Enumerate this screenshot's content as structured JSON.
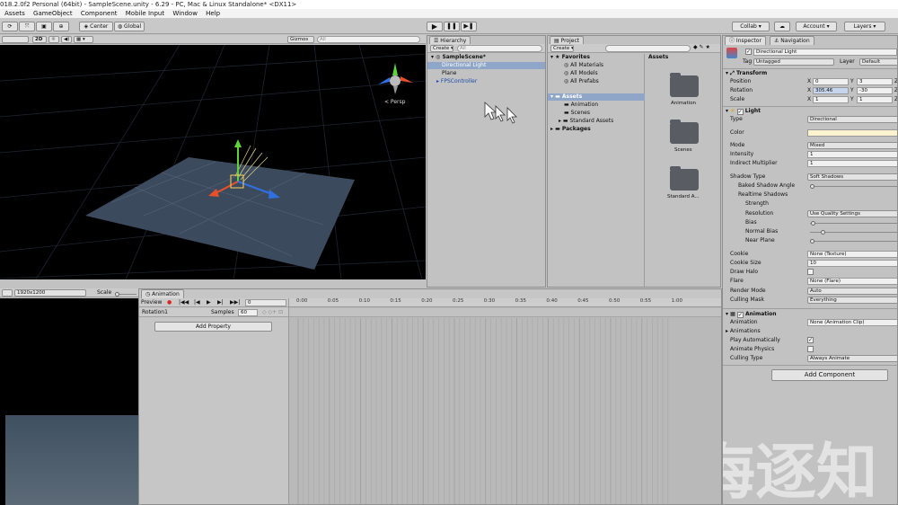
{
  "window": {
    "title": "018.2.0f2 Personal (64bit) - SampleScene.unity - 6.29 - PC, Mac & Linux Standalone* <DX11>"
  },
  "menu": [
    "Assets",
    "GameObject",
    "Component",
    "Mobile Input",
    "Window",
    "Help"
  ],
  "toolbar": {
    "center_label": "Center",
    "global_label": "Global",
    "collab_label": "Collab",
    "account_label": "Account",
    "layers_label": "Layers"
  },
  "scene": {
    "mode_2d": "2D",
    "gizmos_label": "Gizmos",
    "search_placeholder": "All",
    "persp_label": "< Persp"
  },
  "game": {
    "resolution": "1920x1200",
    "scale_label": "Scale"
  },
  "hierarchy": {
    "tab": "Hierarchy",
    "create": "Create",
    "search_placeholder": "All",
    "scene_name": "SampleScene*",
    "items": [
      "Directional Light",
      "Plane",
      "FPSController"
    ]
  },
  "project": {
    "tab": "Project",
    "create": "Create",
    "favorites_label": "Favorites",
    "favorites": [
      "All Materials",
      "All Models",
      "All Prefabs"
    ],
    "assets_label": "Assets",
    "asset_folders": [
      "Animation",
      "Scenes",
      "Standard Assets"
    ],
    "packages_label": "Packages",
    "assets_header": "Assets",
    "grid_items": [
      "Animation",
      "Scenes",
      "Standard A..."
    ]
  },
  "animation": {
    "tab": "Animation",
    "preview_label": "Preview",
    "frame_value": "0",
    "clip_name": "Rotation1",
    "samples_label": "Samples",
    "samples_value": "60",
    "add_property": "Add Property",
    "timeline_ticks": [
      "0:00",
      "0:05",
      "0:10",
      "0:15",
      "0:20",
      "0:25",
      "0:30",
      "0:35",
      "0:40",
      "0:45",
      "0:50",
      "0:55",
      "1:00"
    ]
  },
  "inspector": {
    "tabs": [
      "Inspector",
      "Navigation"
    ],
    "object_name": "Directional Light",
    "tag_label": "Tag",
    "tag_value": "Untagged",
    "layer_label": "Layer",
    "layer_value": "Default",
    "transform": {
      "title": "Transform",
      "position_label": "Position",
      "position": {
        "x": "0",
        "y": "3",
        "z": "Z"
      },
      "rotation_label": "Rotation",
      "rotation": {
        "x": "305.46",
        "y": "-30",
        "z": "Z"
      },
      "scale_label": "Scale",
      "scale": {
        "x": "1",
        "y": "1",
        "z": "Z"
      }
    },
    "light": {
      "title": "Light",
      "type_label": "Type",
      "type_value": "Directional",
      "color_label": "Color",
      "mode_label": "Mode",
      "mode_value": "Mixed",
      "intensity_label": "Intensity",
      "intensity_value": "1",
      "indirect_label": "Indirect Multiplier",
      "indirect_value": "1",
      "shadow_type_label": "Shadow Type",
      "shadow_type_value": "Soft Shadows",
      "baked_angle_label": "Baked Shadow Angle",
      "realtime_label": "Realtime Shadows",
      "strength_label": "Strength",
      "resolution_label": "Resolution",
      "resolution_value": "Use Quality Settings",
      "bias_label": "Bias",
      "normal_bias_label": "Normal Bias",
      "near_plane_label": "Near Plane",
      "cookie_label": "Cookie",
      "cookie_value": "None (Texture)",
      "cookie_size_label": "Cookie Size",
      "cookie_size_value": "10",
      "draw_halo_label": "Draw Halo",
      "flare_label": "Flare",
      "flare_value": "None (Flare)",
      "render_mode_label": "Render Mode",
      "render_mode_value": "Auto",
      "culling_mask_label": "Culling Mask",
      "culling_mask_value": "Everything"
    },
    "animation": {
      "title": "Animation",
      "animation_label": "Animation",
      "animation_value": "None (Animation Clip)",
      "animations_label": "Animations",
      "play_auto_label": "Play Automatically",
      "animate_physics_label": "Animate Physics",
      "culling_type_label": "Culling Type",
      "culling_type_value": "Always Animate"
    },
    "add_component": "Add Component"
  },
  "watermark": "上海逐知",
  "colors": {
    "selection": "#3d6fb6",
    "light_color": "#fff2cf",
    "scene_bg": "#000000"
  }
}
